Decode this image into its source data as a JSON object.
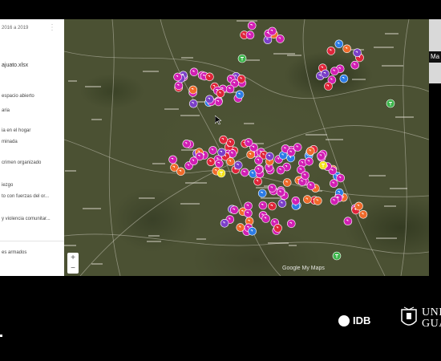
{
  "panel": {
    "title": "2016 a 2019",
    "file": "ajuato.xlsx",
    "layers": [
      "espacio abierto",
      "aria",
      "ia en el hogar",
      "minada",
      "crimen organizado",
      "iezgo",
      "to con fuerzas del or...",
      "y violencia comunitar...",
      "es armados"
    ]
  },
  "map": {
    "zoom_in": "+",
    "zoom_out": "−",
    "attribution": "Google My Maps",
    "marker_colors": {
      "magenta": "#d21fb4",
      "orange": "#f06a2a",
      "red": "#e0253a",
      "blue": "#2d7ce6",
      "yellow": "#f4e21a",
      "green": "#3bb44a",
      "purple": "#7b3fc8"
    }
  },
  "video_tile": {
    "label": "Ma"
  },
  "footer": {
    "idb_name": "IDB",
    "ug_name_line1": "UNI",
    "ug_name_line2": "GUA"
  }
}
